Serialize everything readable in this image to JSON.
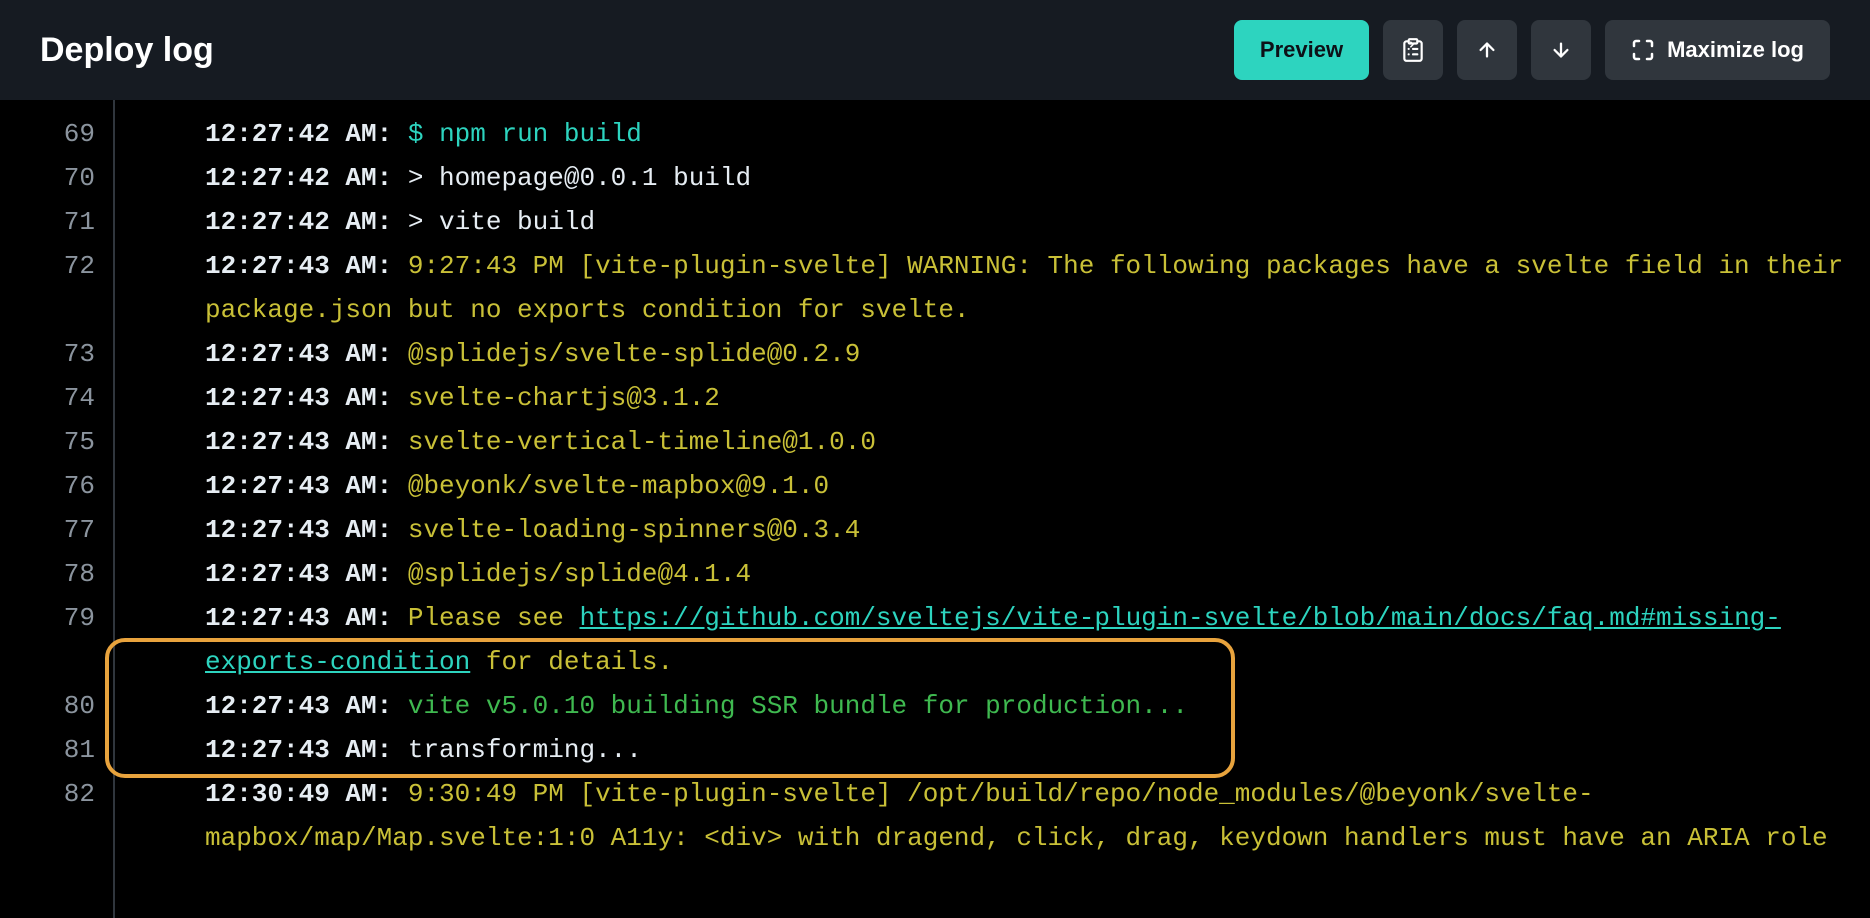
{
  "header": {
    "title": "Deploy log",
    "preview_button": "Preview",
    "maximize_button": "Maximize log"
  },
  "log": {
    "line_numbers": [
      "69",
      "70",
      "71",
      "72",
      "73",
      "74",
      "75",
      "76",
      "77",
      "78",
      "79",
      "80",
      "81",
      "82"
    ],
    "lines": [
      {
        "ts": "12:27:42 AM:",
        "prompt": "$ ",
        "cmd": "npm run build"
      },
      {
        "ts": "12:27:42 AM:",
        "text": "> homepage@0.0.1 build"
      },
      {
        "ts": "12:27:42 AM:",
        "text": "> vite build"
      },
      {
        "ts": "12:27:43 AM:",
        "warning": "9:27:43 PM [vite-plugin-svelte] WARNING: The following packages have a svelte field in their package.json but no exports condition for svelte."
      },
      {
        "ts": "12:27:43 AM:",
        "warning": "@splidejs/svelte-splide@0.2.9"
      },
      {
        "ts": "12:27:43 AM:",
        "warning": "svelte-chartjs@3.1.2"
      },
      {
        "ts": "12:27:43 AM:",
        "warning": "svelte-vertical-timeline@1.0.0"
      },
      {
        "ts": "12:27:43 AM:",
        "warning": "@beyonk/svelte-mapbox@9.1.0"
      },
      {
        "ts": "12:27:43 AM:",
        "warning": "svelte-loading-spinners@0.3.4"
      },
      {
        "ts": "12:27:43 AM:",
        "warning": "@splidejs/splide@4.1.4"
      },
      {
        "ts": "12:27:43 AM:",
        "warning_pre": "Please see ",
        "link": "https://github.com/sveltejs/vite-plugin-svelte/blob/main/docs/faq.md#missing-exports-condition",
        "warning_post": " for details."
      },
      {
        "ts": "12:27:43 AM:",
        "vite_green": "vite v5.0.10 building SSR bundle for production..."
      },
      {
        "ts": "12:27:43 AM:",
        "text": "transforming..."
      },
      {
        "ts": "12:30:49 AM:",
        "warning": "9:30:49 PM [vite-plugin-svelte] /opt/build/repo/node_modules/@beyonk/svelte-mapbox/map/Map.svelte:1:0 A11y: <div> with dragend, click, drag, keydown handlers must have an ARIA role"
      }
    ]
  }
}
